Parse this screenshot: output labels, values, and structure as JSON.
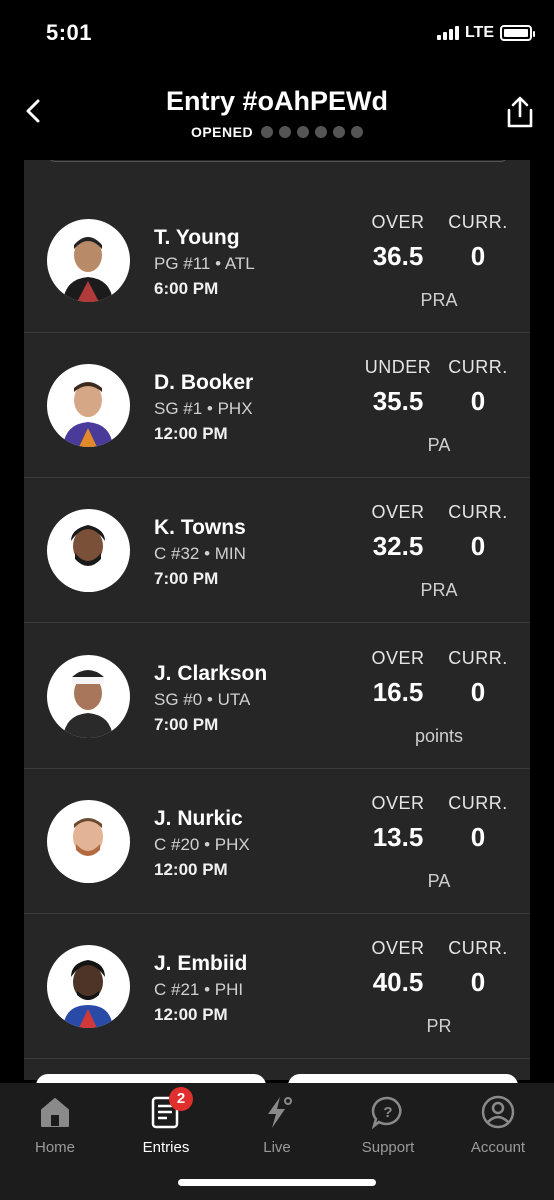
{
  "status_bar": {
    "time": "5:01",
    "network": "LTE"
  },
  "header": {
    "title": "Entry #oAhPEWd",
    "status": "OPENED"
  },
  "picks": [
    {
      "name": "T. Young",
      "position": "PG #11 • ATL",
      "time": "6:00 PM",
      "direction": "OVER",
      "line": "36.5",
      "current_label": "CURR.",
      "current": "0",
      "stat": "PRA"
    },
    {
      "name": "D. Booker",
      "position": "SG #1 • PHX",
      "time": "12:00 PM",
      "direction": "UNDER",
      "line": "35.5",
      "current_label": "CURR.",
      "current": "0",
      "stat": "PA"
    },
    {
      "name": "K. Towns",
      "position": "C #32 • MIN",
      "time": "7:00 PM",
      "direction": "OVER",
      "line": "32.5",
      "current_label": "CURR.",
      "current": "0",
      "stat": "PRA"
    },
    {
      "name": "J. Clarkson",
      "position": "SG #0 • UTA",
      "time": "7:00 PM",
      "direction": "OVER",
      "line": "16.5",
      "current_label": "CURR.",
      "current": "0",
      "stat": "points"
    },
    {
      "name": "J. Nurkic",
      "position": "C #20 • PHX",
      "time": "12:00 PM",
      "direction": "OVER",
      "line": "13.5",
      "current_label": "CURR.",
      "current": "0",
      "stat": "PA"
    },
    {
      "name": "J. Embiid",
      "position": "C #21 • PHI",
      "time": "12:00 PM",
      "direction": "OVER",
      "line": "40.5",
      "current_label": "CURR.",
      "current": "0",
      "stat": "PR"
    }
  ],
  "tabs": {
    "home": {
      "label": "Home",
      "icon": "home-icon"
    },
    "entries": {
      "label": "Entries",
      "icon": "entries-icon",
      "badge": "2"
    },
    "live": {
      "label": "Live",
      "icon": "lightning-icon"
    },
    "support": {
      "label": "Support",
      "icon": "support-icon"
    },
    "account": {
      "label": "Account",
      "icon": "account-icon"
    }
  },
  "colors": {
    "background": "#000000",
    "card": "#262626",
    "badge": "#e0302e",
    "tab_inactive": "#9a9a9a"
  }
}
